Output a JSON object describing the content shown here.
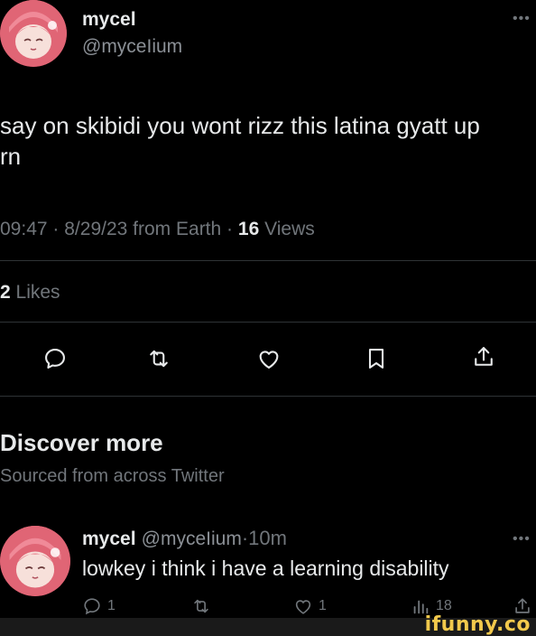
{
  "tweet": {
    "display_name": "mycel",
    "handle": "@myceIium",
    "more_icon": "ellipsis-icon",
    "text_line1": "say on skibidi you wont rizz this latina gyatt up",
    "text_line2": "rn",
    "time": "09:47",
    "sep1": "·",
    "date": "8/29/23",
    "source": "from Earth",
    "sep2": "·",
    "views_count": "16",
    "views_label": "Views",
    "likes_count": "2",
    "likes_label": "Likes"
  },
  "actions": [
    {
      "icon": "reply-icon"
    },
    {
      "icon": "retweet-icon"
    },
    {
      "icon": "heart-icon"
    },
    {
      "icon": "bookmark-icon"
    },
    {
      "icon": "share-icon"
    }
  ],
  "discover": {
    "title": "Discover more",
    "subtitle": "Sourced from across Twitter"
  },
  "reply": {
    "display_name": "mycel",
    "handle": "@myceIium",
    "sep": "·",
    "age": "10m",
    "text": "lowkey i think i have a learning disability",
    "reply_count": "1",
    "retweet_count": "",
    "like_count": "1",
    "views_count": "18"
  },
  "watermark": "ifunny.co",
  "colors": {
    "background": "#000000",
    "text": "#e7e9ea",
    "muted": "#71767b",
    "divider": "#2f3336",
    "watermark": "#f2c94c"
  }
}
